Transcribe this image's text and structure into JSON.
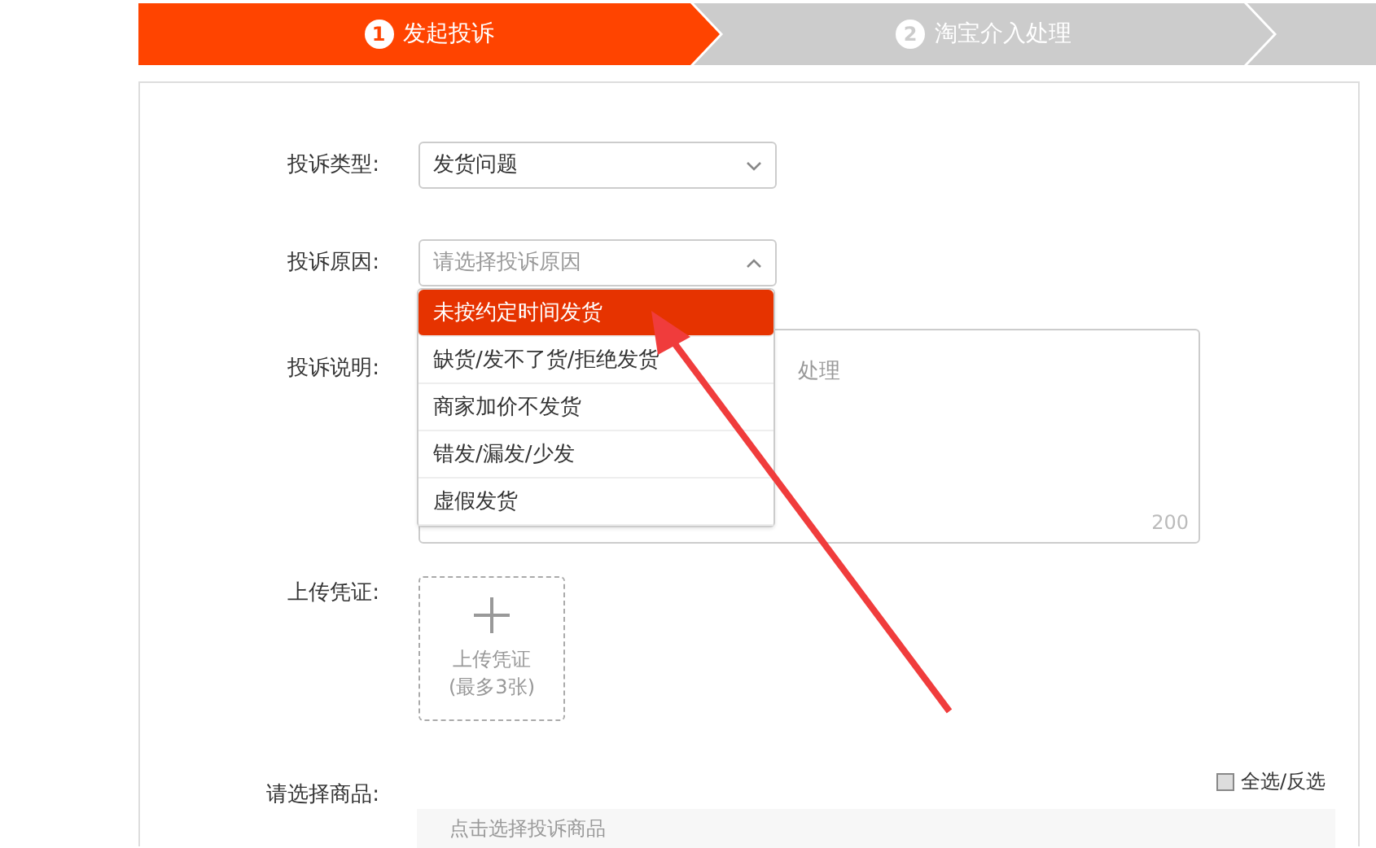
{
  "steps": [
    {
      "number": "1",
      "label": "发起投诉",
      "selected": true
    },
    {
      "number": "2",
      "label": "淘宝介入处理",
      "selected": false
    },
    {
      "selected": false
    }
  ],
  "form": {
    "complaint_type": {
      "label": "投诉类型:",
      "value": "发货问题"
    },
    "reason": {
      "label": "投诉原因:",
      "placeholder": "请选择投诉原因",
      "expanded": true,
      "options": [
        {
          "label": "未按约定时间发货",
          "selected": true
        },
        {
          "label": "缺货/发不了货/拒绝发货",
          "selected": false
        },
        {
          "label": "商家加价不发货",
          "selected": false
        },
        {
          "label": "错发/漏发/少发",
          "selected": false
        },
        {
          "label": "虚假发货",
          "selected": false
        }
      ]
    },
    "description": {
      "label": "投诉说明:",
      "placeholder": "处理",
      "counter": "200"
    },
    "upload": {
      "label": "上传凭证:",
      "button_text": "上传凭证",
      "hint": "(最多3张)"
    },
    "products": {
      "label": "请选择商品:",
      "select_all": {
        "label": "全选/反选",
        "checked": false
      },
      "placeholder": "点击选择投诉商品"
    }
  }
}
